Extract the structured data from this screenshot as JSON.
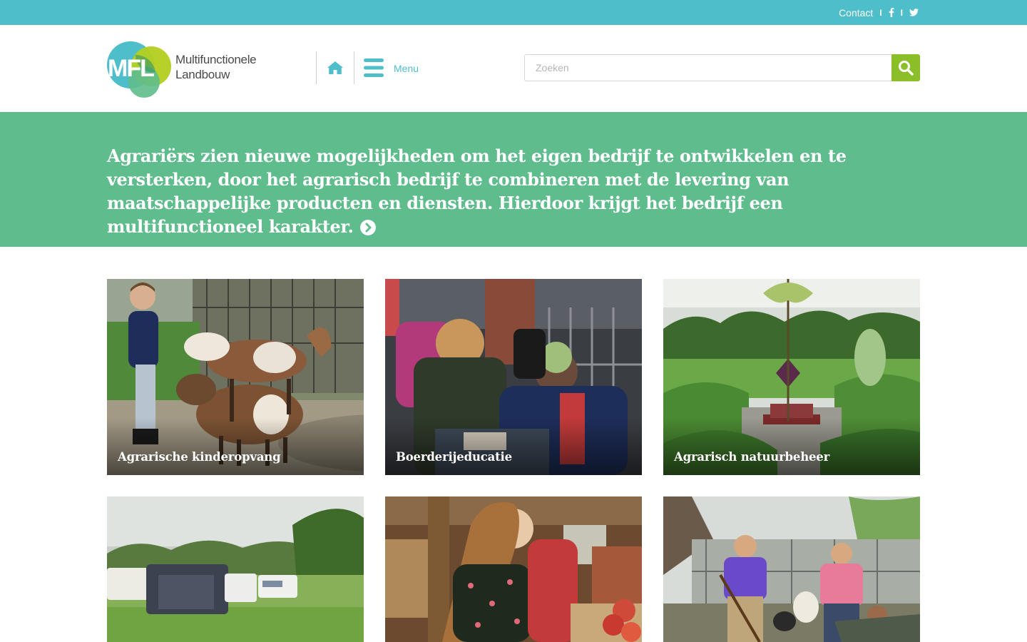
{
  "topbar": {
    "contact_label": "Contact",
    "separator": "I",
    "icons": [
      "facebook-icon",
      "twitter-icon"
    ]
  },
  "header": {
    "logo_mark": "MFL",
    "logo_line1": "Multifunctionele",
    "logo_line2": "Landbouw",
    "menu_label": "Menu",
    "icons": [
      "home-icon",
      "hamburger-icon",
      "search-icon"
    ],
    "search": {
      "placeholder": "Zoeken",
      "value": ""
    }
  },
  "hero": {
    "text": "Agrariërs zien nieuwe mogelijkheden om het eigen bedrijf te ontwikkelen en te versterken, door het agrarisch bedrijf te combineren met de levering van maatschappelijke producten en diensten. Hierdoor krijgt het bedrijf een multifunctioneel karakter.",
    "arrow_icon": "chevron-circle-right-icon"
  },
  "tiles": [
    {
      "title": "Agrarische kinderopvang"
    },
    {
      "title": "Boerderijeducatie"
    },
    {
      "title": "Agrarisch natuurbeheer"
    },
    {
      "title": ""
    },
    {
      "title": ""
    },
    {
      "title": ""
    }
  ],
  "colors": {
    "topbar": "#4fbecb",
    "hero": "#5fbc8c",
    "search_button": "#8bbf2a",
    "menu_accent": "#4fbecb"
  }
}
